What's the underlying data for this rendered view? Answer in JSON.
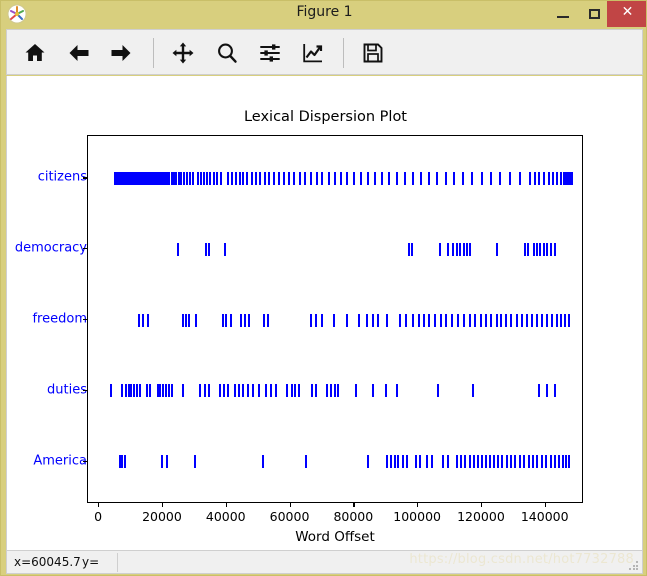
{
  "window": {
    "title": "Figure 1",
    "icon": "matplotlib-logo-icon",
    "minimize_label": "–",
    "maximize_label": "□",
    "close_label": "✕",
    "titlebar_color": "#d8cf7e",
    "close_color": "#c14545"
  },
  "toolbar": {
    "buttons": [
      {
        "name": "home-icon",
        "tooltip": "Reset original view"
      },
      {
        "name": "back-arrow-icon",
        "tooltip": "Back to previous view"
      },
      {
        "name": "forward-arrow-icon",
        "tooltip": "Forward to next view"
      },
      {
        "name": "pan-move-icon",
        "tooltip": "Pan axes with left mouse, zoom with right"
      },
      {
        "name": "zoom-magnifier-icon",
        "tooltip": "Zoom to rectangle"
      },
      {
        "name": "configure-subplots-icon",
        "tooltip": "Configure subplots"
      },
      {
        "name": "edit-axis-curve-icon",
        "tooltip": "Edit axis, curve and image parameters"
      },
      {
        "name": "save-floppy-icon",
        "tooltip": "Save the figure"
      }
    ]
  },
  "statusbar": {
    "x_readout": "x=60045.7",
    "y_readout": "y=",
    "watermark": "https://blog.csdn.net/hot7732788"
  },
  "chart_data": {
    "type": "scatter",
    "title": "Lexical Dispersion Plot",
    "xlabel": "Word Offset",
    "ylabel": "",
    "xlim": [
      -3500,
      152000
    ],
    "ylim": [
      -0.6,
      4.6
    ],
    "grid": false,
    "legend": "none",
    "marker": "vertical-tick",
    "marker_color": "#0000ff",
    "xticks": [
      0,
      20000,
      40000,
      60000,
      80000,
      100000,
      120000,
      140000
    ],
    "xticklabels": [
      "0",
      "20000",
      "40000",
      "60000",
      "80000",
      "100000",
      "120000",
      "140000"
    ],
    "categories": [
      "America",
      "duties",
      "freedom",
      "democracy",
      "citizens"
    ],
    "yticklabels_top_to_bottom": [
      "citizens",
      "democracy",
      "freedom",
      "duties",
      "America"
    ],
    "series": [
      {
        "name": "citizens",
        "row": 4,
        "values": [
          4900,
          5200,
          5450,
          5700,
          6000,
          6250,
          6600,
          7000,
          7300,
          7600,
          7900,
          8200,
          8500,
          8800,
          9200,
          9600,
          10000,
          10400,
          10800,
          11200,
          11600,
          12100,
          12600,
          13000,
          13500,
          14000,
          14500,
          15100,
          15700,
          16300,
          16900,
          17500,
          18100,
          18700,
          19300,
          19900,
          20600,
          21300,
          22000,
          22700,
          23400,
          24200,
          25000,
          25800,
          26600,
          27500,
          28400,
          29300,
          31000,
          31900,
          32800,
          33800,
          34800,
          35900,
          37000,
          38100,
          40400,
          41600,
          42800,
          44000,
          45200,
          46500,
          47800,
          49100,
          50500,
          51900,
          53400,
          54900,
          56400,
          58000,
          59600,
          61200,
          62900,
          64600,
          66400,
          68200,
          70000,
          71900,
          73800,
          75800,
          77800,
          79900,
          82000,
          84200,
          86400,
          88700,
          91000,
          93400,
          95800,
          98300,
          100800,
          103400,
          106000,
          108700,
          111400,
          114200,
          117000,
          119900,
          122800,
          125800,
          128800,
          131900,
          135000,
          136500,
          138000,
          139500,
          141000,
          142400,
          143600,
          144700,
          145600,
          146400,
          147100,
          147700,
          148200
        ]
      },
      {
        "name": "democracy",
        "row": 3,
        "values": [
          24600,
          33500,
          34300,
          39500,
          97000,
          98200,
          107000,
          109500,
          110900,
          112100,
          113200,
          114300,
          115300,
          116400,
          124800,
          133500,
          134400,
          136200,
          137300,
          138300,
          139400,
          140500,
          141500,
          143000
        ]
      },
      {
        "name": "freedom",
        "row": 2,
        "values": [
          12500,
          13800,
          15200,
          26400,
          27300,
          28100,
          30400,
          38700,
          39900,
          41200,
          44500,
          45700,
          46900,
          51600,
          52900,
          66400,
          68100,
          69800,
          73500,
          77800,
          81600,
          84100,
          85900,
          87400,
          90100,
          94300,
          96100,
          98300,
          100300,
          101800,
          103500,
          105400,
          107100,
          108800,
          110600,
          112600,
          114400,
          116300,
          117900,
          119800,
          121400,
          122900,
          124600,
          126100,
          127600,
          129200,
          130900,
          132500,
          134100,
          135800,
          137400,
          138900,
          140400,
          141900,
          143400,
          144900,
          146200,
          147400
        ]
      },
      {
        "name": "duties",
        "row": 1,
        "values": [
          3700,
          7100,
          8300,
          9200,
          10100,
          11000,
          11900,
          12800,
          14900,
          15900,
          18300,
          19200,
          20000,
          20900,
          21800,
          22700,
          26400,
          31500,
          33100,
          34300,
          38000,
          39200,
          40400,
          42700,
          43900,
          45100,
          46800,
          48300,
          50100,
          52400,
          53900,
          55400,
          58900,
          60300,
          61500,
          62700,
          66800,
          68000,
          71400,
          72600,
          73800,
          75000,
          80600,
          85900,
          89900,
          93500,
          106300,
          117200,
          137900,
          140400,
          142900
        ]
      },
      {
        "name": "America",
        "row": 0,
        "values": [
          6500,
          7300,
          8100,
          19800,
          21400,
          30200,
          51400,
          64800,
          84300,
          90200,
          91400,
          92600,
          93800,
          95200,
          96400,
          99300,
          100500,
          102800,
          104200,
          107900,
          109400,
          112200,
          113400,
          114700,
          116300,
          117500,
          118700,
          119900,
          121200,
          122500,
          123700,
          125100,
          126400,
          127800,
          129200,
          130500,
          131900,
          133300,
          134700,
          136100,
          137400,
          138800,
          140200,
          141500,
          142800,
          144100,
          145300,
          146400,
          147300
        ]
      }
    ]
  }
}
